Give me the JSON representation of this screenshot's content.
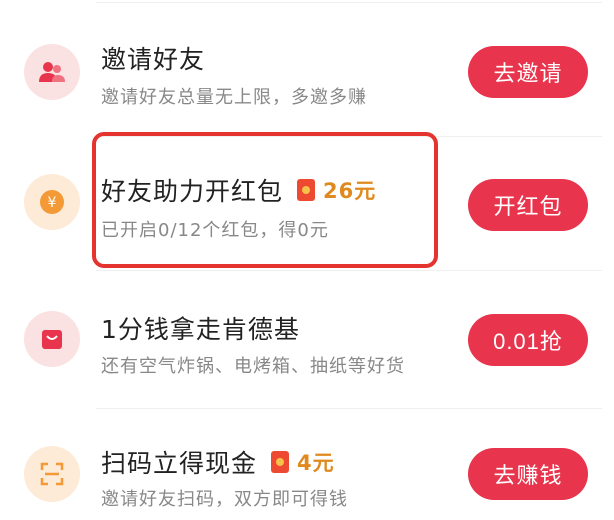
{
  "tasks": [
    {
      "icon": "users-icon",
      "icon_bg": "#fbe2e2",
      "title": "邀请好友",
      "subtitle": "邀请好友总量无上限，多邀多赚",
      "reward": null,
      "button": "去邀请"
    },
    {
      "icon": "yuan-coin-icon",
      "icon_bg": "#fdebd8",
      "title": "好友助力开红包",
      "subtitle": "已开启0/12个红包，得0元",
      "reward": "26元",
      "button": "开红包",
      "highlighted": true
    },
    {
      "icon": "shopping-bag-icon",
      "icon_bg": "#fbe2e2",
      "title": "1分钱拿走肯德基",
      "subtitle": "还有空气炸锅、电烤箱、抽纸等好货",
      "reward": null,
      "button": "0.01抢"
    },
    {
      "icon": "scan-icon",
      "icon_bg": "#fdebd8",
      "title": "扫码立得现金",
      "subtitle": "邀请好友扫码，双方即可得钱",
      "reward": "4元",
      "button": "去赚钱"
    }
  ],
  "colors": {
    "accent": "#e8344c",
    "reward": "#e08a1e",
    "highlight_border": "#e5332f"
  }
}
